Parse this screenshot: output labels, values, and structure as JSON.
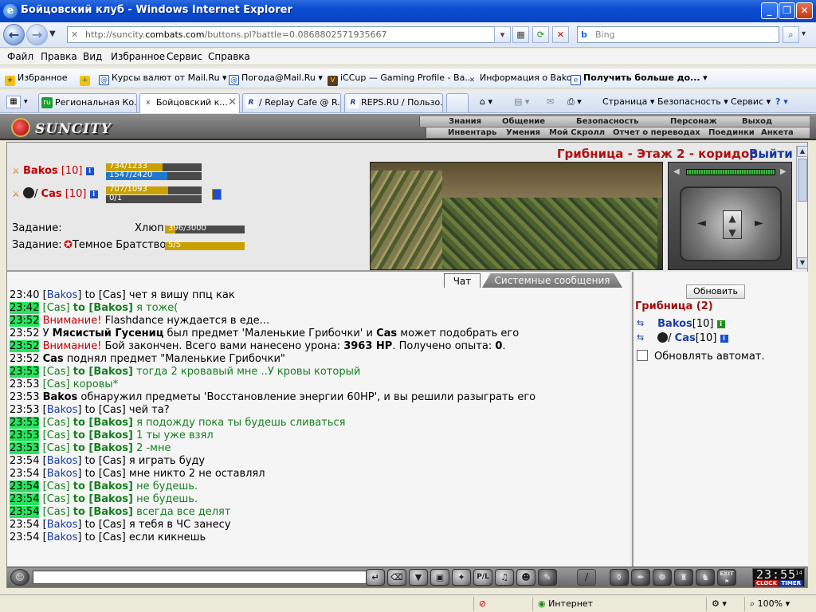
{
  "window": {
    "title": "Бойцовский клуб - Windows Internet Explorer"
  },
  "address": {
    "prefix": "http://suncity.",
    "domain": "combats.com",
    "path": "/buttons.pl?battle=0.0868802571935667"
  },
  "search": {
    "placeholder": "Bing"
  },
  "menu": [
    "Файл",
    "Правка",
    "Вид",
    "Избранное",
    "Сервис",
    "Справка"
  ],
  "favorites": {
    "label": "Избранное",
    "items": [
      "Курсы валют от Mail.Ru",
      "Погода@Mail.Ru",
      "iCCup — Gaming Profile - Ba...",
      "Информация о Bakos"
    ],
    "more": "Получить больше до..."
  },
  "tabs": [
    {
      "label": "Региональная Ко...",
      "icon": "ru"
    },
    {
      "label": "Бойцовский к...",
      "icon": "x"
    },
    {
      "label": "/ Replay Cafe @ R...",
      "icon": "R"
    },
    {
      "label": "REPS.RU / Пользо...",
      "icon": "R"
    }
  ],
  "commands": {
    "page": "Страница",
    "security": "Безопасность",
    "service": "Сервис"
  },
  "game": {
    "brand": "SUNCITY",
    "nav_top": [
      "Знания",
      "Общение",
      "Безопасность",
      "Персонаж",
      "Выход"
    ],
    "nav_bottom": [
      "Инвентарь",
      "Умения",
      "Мой Скролл",
      "Отчет о переводах",
      "Поединки",
      "Анкета"
    ],
    "room_title": "Грибница - Этаж 2 - коридор",
    "exit_label": "Выйти",
    "players": [
      {
        "name": "Bakos",
        "level": "[10]",
        "hp_text": "734/1233",
        "hp_fraction": 0.595,
        "mana_text": "1547/2420",
        "mana_fraction": 0.639
      },
      {
        "name": "Cas",
        "level": "[10]",
        "hp_text": "707/1093",
        "hp_fraction": 0.647,
        "mana_text": "0/1",
        "mana_fraction": 0
      }
    ],
    "tasks": [
      {
        "label": "Задание:",
        "name": "Хлюп",
        "progress_text": "396/3000",
        "progress_fraction": 0.132
      },
      {
        "label": "Задание:",
        "name": "Темное Братство",
        "progress_text": "5/5",
        "progress_fraction": 1
      }
    ],
    "chat_tabs": {
      "chat": "Чат",
      "system": "Системные сообщения"
    },
    "chat": [
      {
        "time": "23:40",
        "hl": false,
        "type": "to",
        "from": "Bakos",
        "to": "Cas",
        "text": "чет я вишу ппц как"
      },
      {
        "time": "23:42",
        "hl": true,
        "type": "pv",
        "from": "Cas",
        "to": "Bakos",
        "text": "я тоже("
      },
      {
        "time": "23:52",
        "hl": true,
        "type": "warn",
        "prefix": "Внимание!",
        "text": "Flashdance нуждается в еде..."
      },
      {
        "time": "23:52",
        "hl": false,
        "type": "sys1",
        "pre": "У ",
        "monster": "Мясистый Гусениц",
        "mid": " был предмет 'Маленькие Грибочки' и ",
        "who": "Cas",
        "post": " может подобрать его"
      },
      {
        "time": "23:52",
        "hl": true,
        "type": "sys2",
        "prefix": "Внимание!",
        "pre": " Бой закончен. Всего вами нанесено урона: ",
        "damage": "3963 HP",
        "mid": ". Получено опыта: ",
        "exp": "0",
        "post": "."
      },
      {
        "time": "23:52",
        "hl": false,
        "type": "sys3",
        "who": "Cas",
        "text": " поднял предмет \"Маленькие Грибочки\""
      },
      {
        "time": "23:53",
        "hl": true,
        "type": "pv",
        "from": "Cas",
        "to": "Bakos",
        "text": "тогда 2 кровавый мне ..У кровы который"
      },
      {
        "time": "23:53",
        "hl": false,
        "type": "self",
        "from": "Cas",
        "text": "коровы*"
      },
      {
        "time": "23:53",
        "hl": false,
        "type": "sys3",
        "who": "Bakos",
        "text": " обнаружил предметы 'Восстановление энергии 60HP', и вы решили разыграть его"
      },
      {
        "time": "23:53",
        "hl": false,
        "type": "to",
        "from": "Bakos",
        "to": "Cas",
        "text": "чей та?"
      },
      {
        "time": "23:53",
        "hl": true,
        "type": "pv",
        "from": "Cas",
        "to": "Bakos",
        "text": "я подожду пока ты будешь сливаться"
      },
      {
        "time": "23:53",
        "hl": true,
        "type": "pv",
        "from": "Cas",
        "to": "Bakos",
        "text": "1 ты уже взял"
      },
      {
        "time": "23:53",
        "hl": true,
        "type": "pv",
        "from": "Cas",
        "to": "Bakos",
        "text": "2 -мне"
      },
      {
        "time": "23:54",
        "hl": false,
        "type": "to",
        "from": "Bakos",
        "to": "Cas",
        "text": "я играть буду"
      },
      {
        "time": "23:54",
        "hl": false,
        "type": "to",
        "from": "Bakos",
        "to": "Cas",
        "text": "мне никто 2 не оставлял"
      },
      {
        "time": "23:54",
        "hl": true,
        "type": "pv",
        "from": "Cas",
        "to": "Bakos",
        "text": "не будешь."
      },
      {
        "time": "23:54",
        "hl": true,
        "type": "pv",
        "from": "Cas",
        "to": "Bakos",
        "text": "не будешь."
      },
      {
        "time": "23:54",
        "hl": true,
        "type": "pv",
        "from": "Cas",
        "to": "Bakos",
        "text": "всегда все делят"
      },
      {
        "time": "23:54",
        "hl": false,
        "type": "to",
        "from": "Bakos",
        "to": "Cas",
        "text": "я тебя в ЧС занесу"
      },
      {
        "time": "23:54",
        "hl": false,
        "type": "to",
        "from": "Bakos",
        "to": "Cas",
        "text": "если кикнешь"
      }
    ],
    "right": {
      "refresh_label": "Обновить",
      "room_name": "Грибница (2)",
      "players": [
        {
          "name": "Bakos",
          "level": "[10]"
        },
        {
          "name": "Cas",
          "level": "[10]"
        }
      ],
      "auto_refresh_label": "Обновлять автомат."
    },
    "clock": {
      "time": "23:55",
      "seconds": "14",
      "label1": "CLOCK",
      "label2": "TIMER"
    }
  },
  "status": {
    "zone": "Интернет",
    "zoom": "100%"
  },
  "colors": {
    "hp": "#c8a000",
    "mana": "#1f78d0",
    "highlight_time": "#29e35f",
    "private": "#15801e",
    "warning": "#c00000"
  }
}
